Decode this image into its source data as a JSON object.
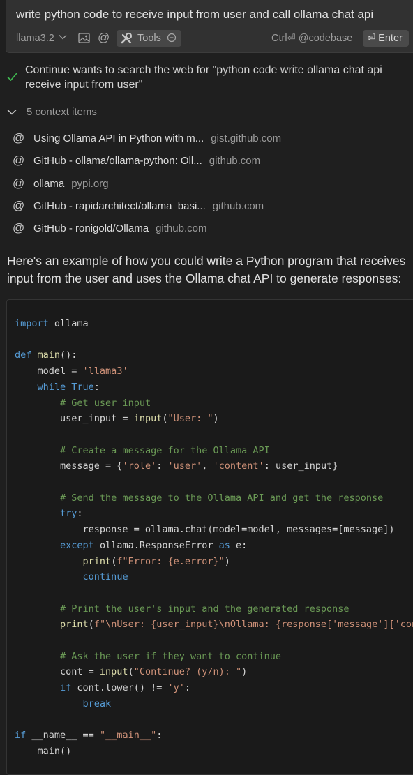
{
  "input": {
    "query": "write python code to receive input from user and call ollama chat api",
    "model": "llama3.2",
    "tools_label": "Tools",
    "shortcut_label": "Ctrl⏎ @codebase",
    "enter_label": "⏎ Enter"
  },
  "status": {
    "text": "Continue wants to search the web for \"python code write ollama chat api receive input from user\""
  },
  "context": {
    "header": "5 context items",
    "items": [
      {
        "title": "Using Ollama API in Python with m...",
        "domain": "gist.github.com"
      },
      {
        "title": "GitHub - ollama/ollama-python: Oll...",
        "domain": "github.com"
      },
      {
        "title": "ollama",
        "domain": "pypi.org"
      },
      {
        "title": "GitHub - rapidarchitect/ollama_basi...",
        "domain": "github.com"
      },
      {
        "title": "GitHub - ronigold/Ollama",
        "domain": "github.com"
      }
    ]
  },
  "response": {
    "intro": "Here's an example of how you could write a Python program that receives input from the user and uses the Ollama chat API to generate responses:",
    "code_lines": [
      [
        [
          "k",
          "import"
        ],
        [
          "v",
          " ollama"
        ]
      ],
      [],
      [
        [
          "k",
          "def"
        ],
        [
          "v",
          " "
        ],
        [
          "f",
          "main"
        ],
        [
          "v",
          "():"
        ]
      ],
      [
        [
          "v",
          "    model = "
        ],
        [
          "s",
          "'llama3'"
        ]
      ],
      [
        [
          "v",
          "    "
        ],
        [
          "k",
          "while"
        ],
        [
          "v",
          " "
        ],
        [
          "k",
          "True"
        ],
        [
          "v",
          ":"
        ]
      ],
      [
        [
          "v",
          "        "
        ],
        [
          "c",
          "# Get user input"
        ]
      ],
      [
        [
          "v",
          "        user_input = "
        ],
        [
          "f",
          "input"
        ],
        [
          "v",
          "("
        ],
        [
          "s",
          "\"User: \""
        ],
        [
          "v",
          ")"
        ]
      ],
      [],
      [
        [
          "v",
          "        "
        ],
        [
          "c",
          "# Create a message for the Ollama API"
        ]
      ],
      [
        [
          "v",
          "        message = {"
        ],
        [
          "s",
          "'role'"
        ],
        [
          "v",
          ": "
        ],
        [
          "s",
          "'user'"
        ],
        [
          "v",
          ", "
        ],
        [
          "s",
          "'content'"
        ],
        [
          "v",
          ": user_input}"
        ]
      ],
      [],
      [
        [
          "v",
          "        "
        ],
        [
          "c",
          "# Send the message to the Ollama API and get the response"
        ]
      ],
      [
        [
          "v",
          "        "
        ],
        [
          "k",
          "try"
        ],
        [
          "v",
          ":"
        ]
      ],
      [
        [
          "v",
          "            response = ollama.chat(model=model, messages=[message])"
        ]
      ],
      [
        [
          "v",
          "        "
        ],
        [
          "k",
          "except"
        ],
        [
          "v",
          " ollama.ResponseError "
        ],
        [
          "k",
          "as"
        ],
        [
          "v",
          " e:"
        ]
      ],
      [
        [
          "v",
          "            "
        ],
        [
          "f",
          "print"
        ],
        [
          "v",
          "("
        ],
        [
          "s",
          "f\"Error: {e.error}\""
        ],
        [
          "v",
          ")"
        ]
      ],
      [
        [
          "v",
          "            "
        ],
        [
          "k",
          "continue"
        ]
      ],
      [],
      [
        [
          "v",
          "        "
        ],
        [
          "c",
          "# Print the user's input and the generated response"
        ]
      ],
      [
        [
          "v",
          "        "
        ],
        [
          "f",
          "print"
        ],
        [
          "v",
          "("
        ],
        [
          "s",
          "f\"\\nUser: {user_input}\\nOllama: {response['message']['content']}\""
        ],
        [
          "v",
          ")"
        ]
      ],
      [],
      [
        [
          "v",
          "        "
        ],
        [
          "c",
          "# Ask the user if they want to continue"
        ]
      ],
      [
        [
          "v",
          "        cont = "
        ],
        [
          "f",
          "input"
        ],
        [
          "v",
          "("
        ],
        [
          "s",
          "\"Continue? (y/n): \""
        ],
        [
          "v",
          ")"
        ]
      ],
      [
        [
          "v",
          "        "
        ],
        [
          "k",
          "if"
        ],
        [
          "v",
          " cont.lower() != "
        ],
        [
          "s",
          "'y'"
        ],
        [
          "v",
          ":"
        ]
      ],
      [
        [
          "v",
          "            "
        ],
        [
          "k",
          "break"
        ]
      ],
      [],
      [
        [
          "k",
          "if"
        ],
        [
          "v",
          " __name__ == "
        ],
        [
          "s",
          "\"__main__\""
        ],
        [
          "v",
          ":"
        ]
      ],
      [
        [
          "v",
          "    main()"
        ]
      ]
    ]
  },
  "colors": {
    "background": "#1f1f1f",
    "input_background": "#313131",
    "check_green": "#3fb950",
    "keyword": "#569cd6",
    "string": "#ce9178",
    "comment": "#6a9955",
    "function": "#dcdcaa"
  }
}
